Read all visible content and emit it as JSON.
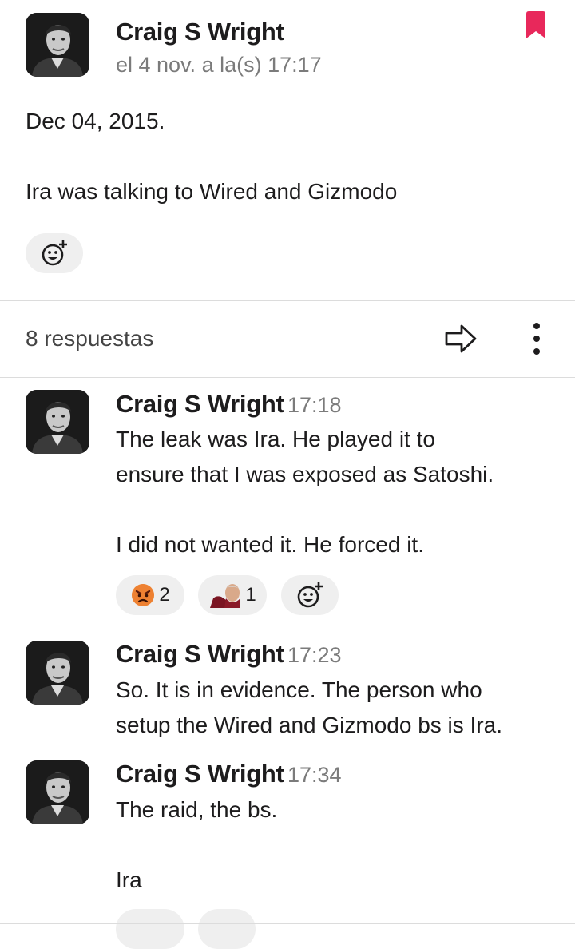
{
  "thread": {
    "parent": {
      "author": "Craig S Wright",
      "timestamp": "el 4 nov. a la(s) 17:17",
      "lines": [
        "Dec 04, 2015.",
        "Ira was talking to Wired and Gizmodo"
      ]
    },
    "replies_label": "8 respuestas",
    "replies": [
      {
        "author": "Craig S Wright",
        "time": "17:18",
        "text": "The leak was Ira. He played it to\nensure that I was exposed as Satoshi.\n\nI did not wanted it. He forced it.",
        "reactions": [
          {
            "icon": "angry-face-emoji",
            "count": "2"
          },
          {
            "icon": "custom-person-emoji",
            "count": "1"
          }
        ]
      },
      {
        "author": "Craig S Wright",
        "time": "17:23",
        "text": "So. It is in evidence. The person who\nsetup the Wired and Gizmodo bs is Ira."
      },
      {
        "author": "Craig S Wright",
        "time": "17:34",
        "text": "The raid, the bs.\n\nIra"
      }
    ]
  },
  "icons": {
    "bookmark": "bookmark-icon",
    "add_reaction": "add-reaction-icon",
    "share": "share-arrow-icon",
    "more": "more-vertical-icon"
  },
  "colors": {
    "bookmark": "#e8285b",
    "pill": "#efefef",
    "timestamp": "#7b7b7b"
  }
}
